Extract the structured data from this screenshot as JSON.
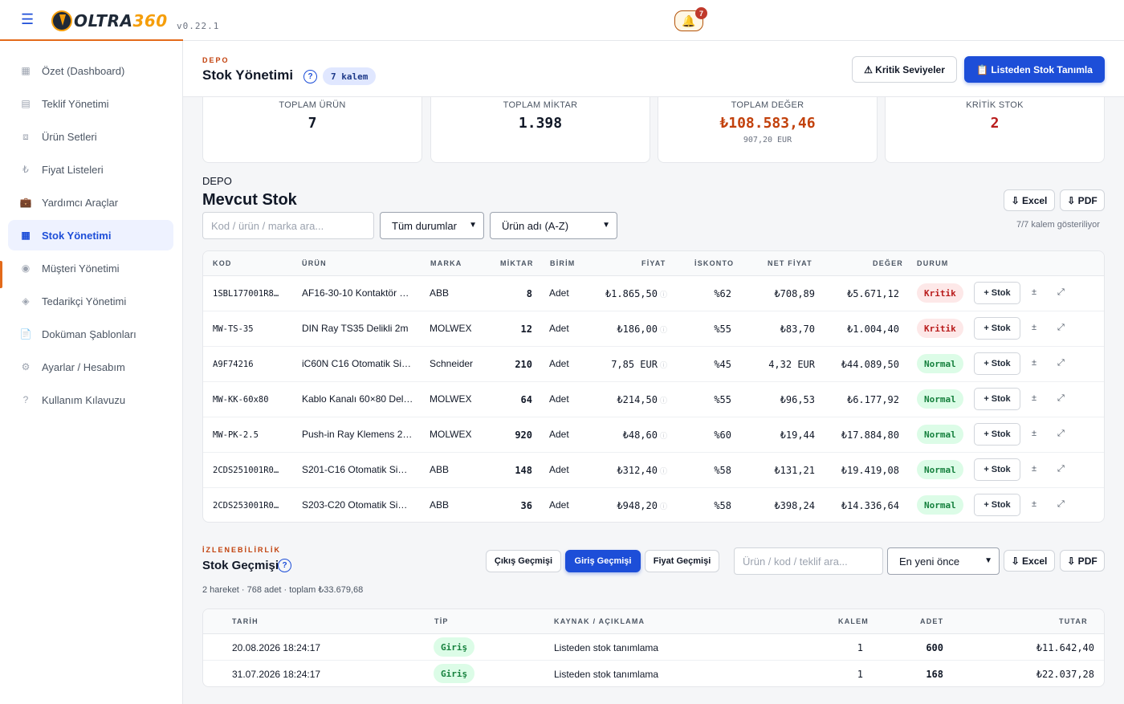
{
  "app": {
    "logo_text": "OLTRA",
    "logo_num": "360",
    "version": "v0.22.1",
    "notification_count": "7"
  },
  "sidebar": {
    "items": [
      {
        "label": "Özet (Dashboard)",
        "icon": "dashboard-icon",
        "glyph": "▦"
      },
      {
        "label": "Teklif Yönetimi",
        "icon": "document-icon",
        "glyph": "▤"
      },
      {
        "label": "Ürün Setleri",
        "icon": "box-icon",
        "glyph": "⧈"
      },
      {
        "label": "Fiyat Listeleri",
        "icon": "lira-icon",
        "glyph": "₺"
      },
      {
        "label": "Yardımcı Araçlar",
        "icon": "briefcase-icon",
        "glyph": "💼"
      },
      {
        "label": "Stok Yönetimi",
        "icon": "stock-icon",
        "glyph": "▦"
      },
      {
        "label": "Müşteri Yönetimi",
        "icon": "user-icon",
        "glyph": "◉"
      },
      {
        "label": "Tedarikçi Yönetimi",
        "icon": "supplier-icon",
        "glyph": "◈"
      },
      {
        "label": "Doküman Şablonları",
        "icon": "template-icon",
        "glyph": "📄"
      },
      {
        "label": "Ayarlar / Hesabım",
        "icon": "gear-icon",
        "glyph": "⚙"
      },
      {
        "label": "Kullanım Kılavuzu",
        "icon": "help-icon",
        "glyph": "?"
      }
    ]
  },
  "header": {
    "eyebrow": "DEPO",
    "title": "Stok Yönetimi",
    "item_count": "7 kalem",
    "critical_btn": "⚠ Kritik Seviyeler",
    "define_btn": "📋 Listeden Stok Tanımla"
  },
  "stats": [
    {
      "label": "TOPLAM ÜRÜN",
      "value": "7",
      "sub": ""
    },
    {
      "label": "TOPLAM MİKTAR",
      "value": "1.398",
      "sub": ""
    },
    {
      "label": "TOPLAM DEĞER",
      "value": "₺108.583,46",
      "sub": "907,20 EUR"
    },
    {
      "label": "KRİTİK STOK",
      "value": "2",
      "sub": ""
    }
  ],
  "colors": {
    "accent": "#e36a1a",
    "primary": "#1d4ed8",
    "value_orange": "#c2410c",
    "critical_red": "#b91c1c"
  },
  "stock": {
    "eyebrow": "DEPO",
    "title": "Mevcut Stok",
    "excel_btn": "⇩ Excel",
    "pdf_btn": "⇩ PDF",
    "search_placeholder": "Kod / ürün / marka ara...",
    "status_filter": "Tüm durumlar",
    "sort": "Ürün adı (A-Z)",
    "shown_text": "7/7 kalem gösteriliyor",
    "columns": [
      "KOD",
      "ÜRÜN",
      "MARKA",
      "MİKTAR",
      "BİRİM",
      "FİYAT",
      "İSKONTO",
      "NET FİYAT",
      "DEĞER",
      "DURUM"
    ],
    "add_stock_label": "+ Stok",
    "rows": [
      {
        "code": "1SBL177001R8…",
        "product": "AF16-30-10 Kontaktör …",
        "brand": "ABB",
        "qty": "8",
        "unit": "Adet",
        "price": "₺1.865,50",
        "discount": "%62",
        "net": "₺708,89",
        "value": "₺5.671,12",
        "status": "Kritik"
      },
      {
        "code": "MW-TS-35",
        "product": "DIN Ray TS35 Delikli 2m",
        "brand": "MOLWEX",
        "qty": "12",
        "unit": "Adet",
        "price": "₺186,00",
        "discount": "%55",
        "net": "₺83,70",
        "value": "₺1.004,40",
        "status": "Kritik"
      },
      {
        "code": "A9F74216",
        "product": "iC60N C16 Otomatik Si…",
        "brand": "Schneider",
        "qty": "210",
        "unit": "Adet",
        "price": "7,85 EUR",
        "discount": "%45",
        "net": "4,32 EUR",
        "value": "₺44.089,50",
        "status": "Normal"
      },
      {
        "code": "MW-KK-60x80",
        "product": "Kablo Kanalı 60×80 Del…",
        "brand": "MOLWEX",
        "qty": "64",
        "unit": "Adet",
        "price": "₺214,50",
        "discount": "%55",
        "net": "₺96,53",
        "value": "₺6.177,92",
        "status": "Normal"
      },
      {
        "code": "MW-PK-2.5",
        "product": "Push-in Ray Klemens 2…",
        "brand": "MOLWEX",
        "qty": "920",
        "unit": "Adet",
        "price": "₺48,60",
        "discount": "%60",
        "net": "₺19,44",
        "value": "₺17.884,80",
        "status": "Normal"
      },
      {
        "code": "2CDS251001R0…",
        "product": "S201-C16 Otomatik Si…",
        "brand": "ABB",
        "qty": "148",
        "unit": "Adet",
        "price": "₺312,40",
        "discount": "%58",
        "net": "₺131,21",
        "value": "₺19.419,08",
        "status": "Normal"
      },
      {
        "code": "2CDS253001R0…",
        "product": "S203-C20 Otomatik Si…",
        "brand": "ABB",
        "qty": "36",
        "unit": "Adet",
        "price": "₺948,20",
        "discount": "%58",
        "net": "₺398,24",
        "value": "₺14.336,64",
        "status": "Normal"
      }
    ]
  },
  "history": {
    "eyebrow": "İZLENEBİLİRLİK",
    "title": "Stok Geçmişi",
    "summary": "2 hareket · 768 adet · toplam ₺33.679,68",
    "tabs": [
      "Çıkış Geçmişi",
      "Giriş Geçmişi",
      "Fiyat Geçmişi"
    ],
    "active_tab": "Giriş Geçmişi",
    "search_placeholder": "Ürün / kod / teklif ara...",
    "sort": "En yeni önce",
    "excel_btn": "⇩ Excel",
    "pdf_btn": "⇩ PDF",
    "columns": [
      "TARİH",
      "TİP",
      "KAYNAK / AÇIKLAMA",
      "KALEM",
      "ADET",
      "TUTAR"
    ],
    "rows": [
      {
        "date": "20.08.2026 18:24:17",
        "type": "Giriş",
        "source": "Listeden stok tanımlama",
        "items": "1",
        "qty": "600",
        "amount": "₺11.642,40"
      },
      {
        "date": "31.07.2026 18:24:17",
        "type": "Giriş",
        "source": "Listeden stok tanımlama",
        "items": "1",
        "qty": "168",
        "amount": "₺22.037,28"
      }
    ]
  }
}
